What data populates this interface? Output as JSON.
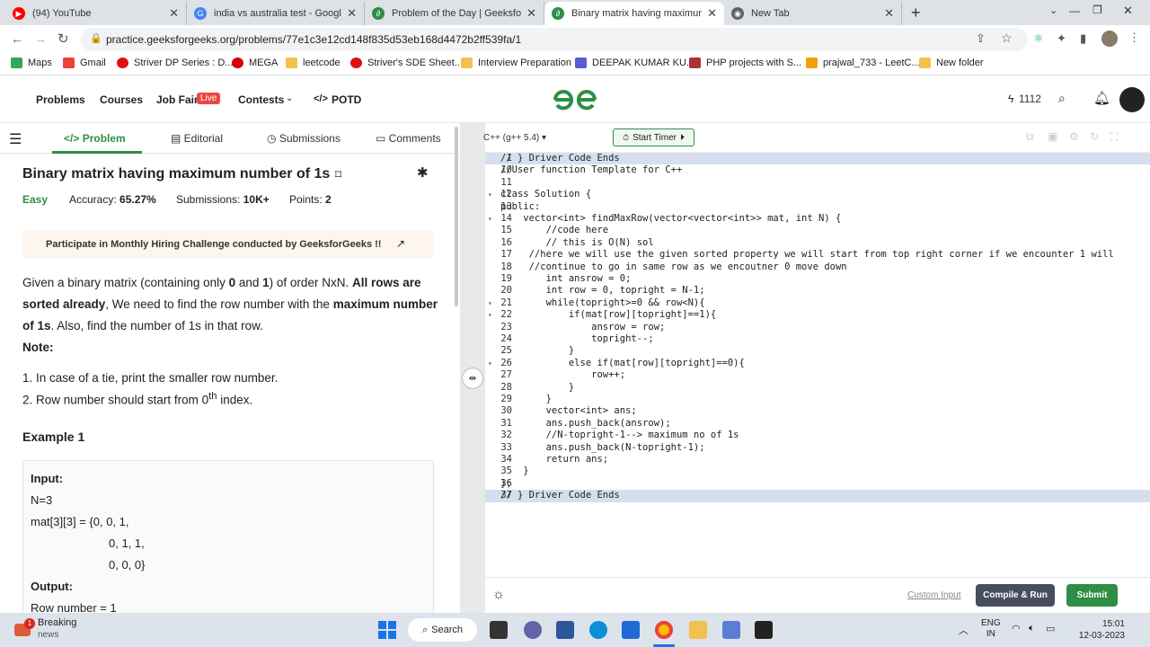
{
  "browser": {
    "tabs": [
      {
        "title": "(94) YouTube",
        "color": "#ff0000"
      },
      {
        "title": "india vs australia test - Google Se",
        "color": "#4285f4"
      },
      {
        "title": "Problem of the Day | GeeksforGee",
        "color": "#2f8d46"
      },
      {
        "title": "Binary matrix having maximum n",
        "color": "#2f8d46"
      },
      {
        "title": "New Tab",
        "color": "#5f6368"
      }
    ],
    "url": "practice.geeksforgeeks.org/problems/77e1c3e12cd148f835d53eb168d4472b2ff539fa/1",
    "bookmarks": [
      "Maps",
      "Gmail",
      "Striver DP Series : D...",
      "MEGA",
      "leetcode",
      "Striver's SDE Sheet...",
      "Interview Preparation",
      "DEEPAK KUMAR KU...",
      "PHP projects with S...",
      "prajwal_733 - LeetC...",
      "New folder"
    ]
  },
  "header": {
    "nav": [
      "Problems",
      "Courses",
      "Job Fair",
      "Contests",
      "POTD"
    ],
    "live_badge": "Live",
    "logo": "GfG",
    "streak": "1112"
  },
  "left": {
    "tabs": [
      "Problem",
      "Editorial",
      "Submissions",
      "Comments"
    ],
    "title": "Binary matrix having maximum number of 1s",
    "difficulty": "Easy",
    "accuracy_label": "Accuracy:",
    "accuracy": "65.27%",
    "submissions_label": "Submissions:",
    "submissions": "10K+",
    "points_label": "Points:",
    "points": "2",
    "banner": "Participate in Monthly Hiring Challenge conducted by GeeksforGeeks !!",
    "desc": {
      "p1": "Given a binary matrix (containing only ",
      "b1": "0",
      "p2": " and ",
      "b2": "1",
      "p3": ") of order NxN. ",
      "b3": "All rows are sorted already",
      "p4": ", We need to find the row number with the ",
      "b4": "maximum number of 1s",
      "p5": ". Also, find the number of 1s in that row."
    },
    "note_title": "Note:",
    "note1": "1. In case of a tie, print the smaller row number.",
    "note2_pre": "2. Row number should start from 0",
    "note2_sup": "th",
    "note2_post": " index.",
    "example_title": "Example 1",
    "input_label": "Input:",
    "input_lines": [
      "N=3",
      "mat[3][3] = {0, 0, 1,",
      "0, 1, 1,",
      "0, 0, 0}"
    ],
    "output_label": "Output:",
    "output_line": "Row number = 1"
  },
  "editor": {
    "language": "C++ (g++ 5.4)",
    "timer": "Start Timer",
    "lines": [
      {
        "n": "1",
        "t": "// } Driver Code Ends"
      },
      {
        "n": "10",
        "t": "//User function Template for C++"
      },
      {
        "n": "11",
        "t": ""
      },
      {
        "n": "12",
        "t": "class Solution {"
      },
      {
        "n": "13",
        "t": "public:"
      },
      {
        "n": "14",
        "t": "    vector<int> findMaxRow(vector<vector<int>> mat, int N) {"
      },
      {
        "n": "15",
        "t": "        //code here"
      },
      {
        "n": "16",
        "t": "        // this is O(N) sol"
      },
      {
        "n": "17",
        "t": "     //here we will use the given sorted property we will start from top right corner if we encounter 1 will"
      },
      {
        "n": "18",
        "t": "     //continue to go in same row as we encoutner 0 move down"
      },
      {
        "n": "19",
        "t": "        int ansrow = 0;"
      },
      {
        "n": "20",
        "t": "        int row = 0, topright = N-1;"
      },
      {
        "n": "21",
        "t": "        while(topright>=0 && row<N){"
      },
      {
        "n": "22",
        "t": "            if(mat[row][topright]==1){"
      },
      {
        "n": "23",
        "t": "                ansrow = row;"
      },
      {
        "n": "24",
        "t": "                topright--;"
      },
      {
        "n": "25",
        "t": "            }"
      },
      {
        "n": "26",
        "t": "            else if(mat[row][topright]==0){"
      },
      {
        "n": "27",
        "t": "                row++;"
      },
      {
        "n": "28",
        "t": "            }"
      },
      {
        "n": "29",
        "t": "        }"
      },
      {
        "n": "30",
        "t": "        vector<int> ans;"
      },
      {
        "n": "31",
        "t": "        ans.push_back(ansrow);"
      },
      {
        "n": "32",
        "t": "        //N-topright-1--> maximum no of 1s"
      },
      {
        "n": "33",
        "t": "        ans.push_back(N-topright-1);"
      },
      {
        "n": "34",
        "t": "        return ans;"
      },
      {
        "n": "35",
        "t": "    }"
      },
      {
        "n": "36",
        "t": "};"
      },
      {
        "n": "37",
        "t": "// } Driver Code Ends"
      }
    ],
    "custom_input": "Custom Input",
    "compile_run": "Compile & Run",
    "submit": "Submit"
  },
  "taskbar": {
    "news_title": "Breaking",
    "news_sub": "news",
    "news_badge": "1",
    "search": "Search",
    "lang1": "ENG",
    "lang2": "IN",
    "time": "15:01",
    "date": "12-03-2023"
  }
}
